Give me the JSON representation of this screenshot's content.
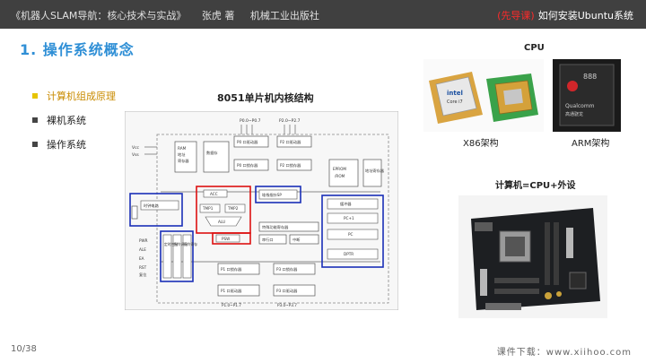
{
  "header": {
    "book_title": "《机器人SLAM导航：核心技术与实战》",
    "author": "张虎 著",
    "publisher": "机械工业出版社",
    "tag": "(先导课)",
    "topic": "如何安装Ubuntu系统"
  },
  "title": "1. 操作系统概念",
  "bullets": [
    "计算机组成原理",
    "裸机系统",
    "操作系统"
  ],
  "diagram": {
    "title": "8051单片机内核结构",
    "labels": {
      "p0": "P0.0~P0.7",
      "p2": "P2.0~P2.7",
      "vcc": "Vcc",
      "vss": "Vss",
      "ram": "RAM",
      "ram_addr": "地址",
      "ram_reg": "寄存器",
      "data_mem": "数据存",
      "p0_drv": "P0 口驱动器",
      "p2_drv": "P2 口驱动器",
      "p0_latch": "P0 口锁存器",
      "p2_latch": "P2 口锁存器",
      "eprom": "EPROM",
      "rom": "/ROM",
      "acc": "ACC",
      "tmp1": "TMP1",
      "tmp2": "TMP2",
      "alu": "ALU",
      "psw": "PSW",
      "stack": "堆栈指针SP",
      "osc": "时钟电路",
      "timer": "特殊功能寄存器",
      "serial": "串行口",
      "interrupt": "中断",
      "buffer": "缓冲器",
      "pc_inc": "PC+1",
      "pc": "PC",
      "dptr": "DPTR",
      "addr_reg": "地址寄存器",
      "ctrl": [
        "定时控制",
        "指令译码",
        "指令寄存"
      ],
      "pwr": "PWR",
      "ale": "ALE",
      "ea": "EA",
      "rst": "RST",
      "reset": "复位",
      "p1_latch": "P1 口锁存器",
      "p3_latch": "P3 口锁存器",
      "p1_drv": "P1 口驱动器",
      "p3_drv": "P3 口驱动器",
      "p1": "P1.0~P1.7",
      "p3": "P3.0~P3.7"
    }
  },
  "cpu": {
    "title": "CPU",
    "x86_caption": "X86架构",
    "arm_caption": "ARM架构",
    "intel_mark": "intel",
    "intel_model": "Core i7",
    "arm_chip_text": "888",
    "arm_brand": "Qualcomm",
    "arm_sub": "高通骁龙"
  },
  "computer": {
    "title": "计算机=CPU+外设"
  },
  "footer": {
    "page": "10/38",
    "site": "课件下载：www.xiihoo.com"
  }
}
